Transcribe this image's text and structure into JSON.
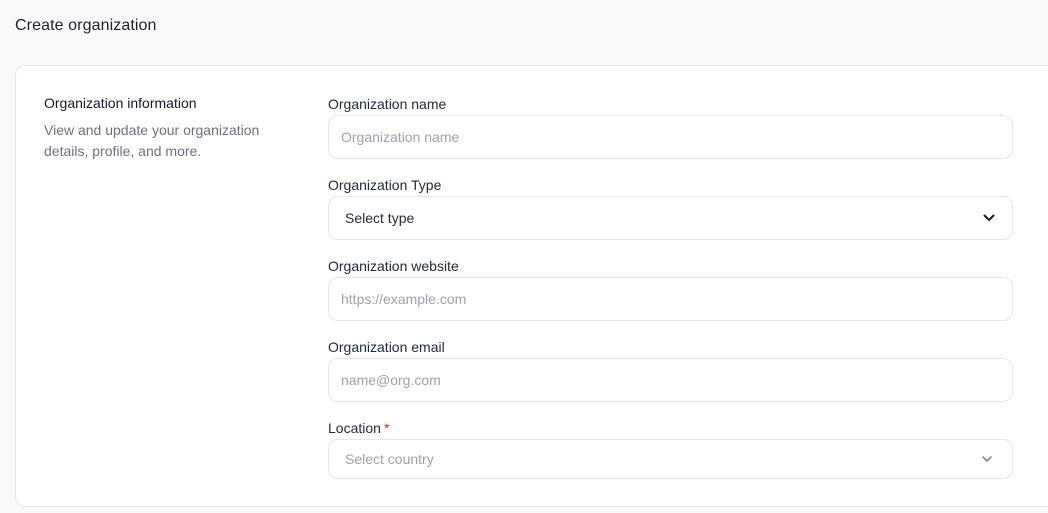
{
  "page": {
    "title": "Create organization"
  },
  "section": {
    "title": "Organization information",
    "description": "View and update your organization details, profile, and more."
  },
  "fields": {
    "name": {
      "label": "Organization name",
      "placeholder": "Organization name",
      "value": ""
    },
    "type": {
      "label": "Organization Type",
      "selected": "Select type",
      "icon": "chevron-down-icon"
    },
    "website": {
      "label": "Organization website",
      "placeholder": "https://example.com",
      "value": ""
    },
    "email": {
      "label": "Organization email",
      "placeholder": "name@org.com",
      "value": ""
    },
    "location": {
      "label": "Location",
      "required_marker": "*",
      "placeholder": "Select country",
      "icon": "chevron-down-icon"
    }
  },
  "colors": {
    "required": "#dc2626",
    "border": "#e5e7eb",
    "placeholder": "#9ca3af"
  }
}
